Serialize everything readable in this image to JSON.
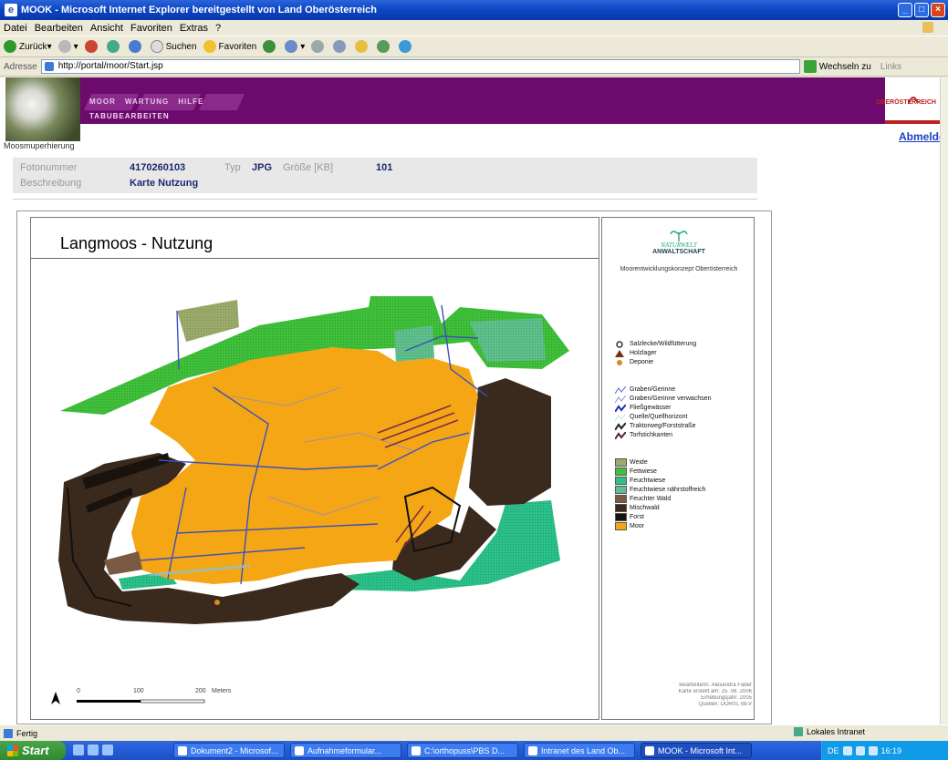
{
  "window": {
    "title": "MOOK - Microsoft Internet Explorer bereitgestellt von Land Oberösterreich"
  },
  "menu": [
    "Datei",
    "Bearbeiten",
    "Ansicht",
    "Favoriten",
    "Extras",
    "?"
  ],
  "toolbar": {
    "back": "Zurück",
    "search": "Suchen",
    "favorites": "Favoriten"
  },
  "address": {
    "label": "Adresse",
    "url": "http://portal/moor/Start.jsp",
    "go": "Wechseln zu",
    "links": "Links"
  },
  "site": {
    "photo_caption": "Moosmuperhierung",
    "tabs": [
      "MOOR",
      "WARTUNG",
      "HILFE"
    ],
    "subnav": "TABUBEARBEITEN",
    "logo_text": "OBERÖSTERREICH",
    "logout": "Abmelden"
  },
  "meta": {
    "photo_number_label": "Fotonummer",
    "photo_number": "4170260103",
    "type_label": "Typ",
    "type": "JPG",
    "size_label": "Größe [KB]",
    "size": "101",
    "description_label": "Beschreibung",
    "description": "Karte Nutzung"
  },
  "map": {
    "title": "Langmoos - Nutzung",
    "brand_line1": "NATURWELT",
    "brand_line2": "ANWALTSCHAFT",
    "concept": "Moorentwicklungskonzept Oberösterreich",
    "point_legend": [
      {
        "label": "Salzlecke/Wildfütterung",
        "color": "#333333",
        "shape": "circle"
      },
      {
        "label": "Holzlager",
        "color": "#7a2e14",
        "shape": "triangle"
      },
      {
        "label": "Deponie",
        "color": "#d98a1a",
        "shape": "star"
      }
    ],
    "line_legend": [
      {
        "label": "Graben/Gerinne",
        "color": "#5566cc"
      },
      {
        "label": "Graben/Gerinne verwachsen",
        "color": "#8b8bd8"
      },
      {
        "label": "Fließgewässer",
        "color": "#1b2fb5"
      },
      {
        "label": "Quelle/Quellhorizont",
        "color": "#7ec8e8"
      },
      {
        "label": "Traktorweg/Forststraße",
        "color": "#222222"
      },
      {
        "label": "Torfstichkanten",
        "color": "#5a1e3c"
      }
    ],
    "area_legend": [
      {
        "label": "Weide",
        "color": "#9aaa6b"
      },
      {
        "label": "Fettwiese",
        "color": "#3fbf3a"
      },
      {
        "label": "Feuchtwiese",
        "color": "#2bc08a"
      },
      {
        "label": "Feuchtwiese nährstoffreich",
        "color": "#5fbf8a"
      },
      {
        "label": "Feuchter Wald",
        "color": "#7b5a44"
      },
      {
        "label": "Mischwald",
        "color": "#3a2a1e"
      },
      {
        "label": "Forst",
        "color": "#1a120c"
      },
      {
        "label": "Moor",
        "color": "#f4a614"
      }
    ],
    "scale": {
      "s0": "0",
      "s1": "100",
      "s2": "200",
      "unit": "Meters"
    },
    "credits": [
      "Bearbeiterin: Alexandra Faber",
      "Karte erstellt am: 25. 08. 2006",
      "Erhebungsjahr: 2005",
      "Quellen: DORIS, BEV"
    ],
    "north": "N"
  },
  "status": {
    "text": "Fertig",
    "zone": "Lokales Intranet"
  },
  "taskbar": {
    "start": "Start",
    "tasks": [
      "Dokument2 - Microsof...",
      "Aufnahmeformular...",
      "C:\\orthopuss\\PBS D...",
      "Intranet des Land Ob...",
      "MOOK - Microsoft Int..."
    ],
    "clock": "16:19",
    "lang": "DE"
  }
}
